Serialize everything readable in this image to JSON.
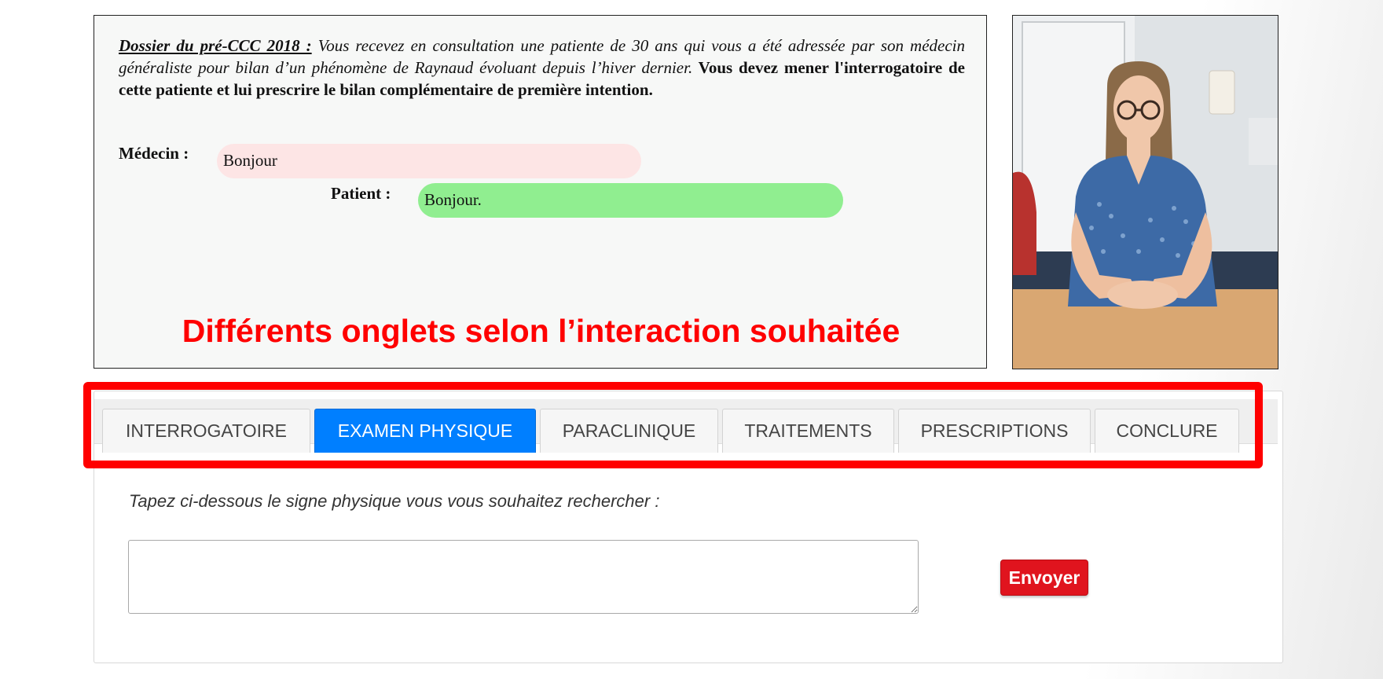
{
  "case": {
    "label": "Dossier du pré-CCC 2018 :",
    "intro": " Vous recevez en consultation une patiente de 30 ans qui vous a été adressée par son médecin généraliste pour bilan d’un phénomène de Raynaud évoluant depuis l’hiver dernier.",
    "task": " Vous devez mener l'interrogatoire de cette patiente et lui prescrire le bilan complémentaire de première intention."
  },
  "dialogue": {
    "doctor_label": "Médecin :",
    "doctor_text": "Bonjour",
    "patient_label": "Patient :",
    "patient_text": "Bonjour."
  },
  "overlay_caption": "Différents onglets selon l’interaction souhaitée",
  "tabs": [
    {
      "label": "INTERROGATOIRE",
      "active": false
    },
    {
      "label": "EXAMEN PHYSIQUE",
      "active": true
    },
    {
      "label": "PARACLINIQUE",
      "active": false
    },
    {
      "label": "TRAITEMENTS",
      "active": false
    },
    {
      "label": "PRESCRIPTIONS",
      "active": false
    },
    {
      "label": "CONCLURE",
      "active": false
    }
  ],
  "exam": {
    "instruction": "Tapez ci-dessous le signe physique vous vous souhaitez rechercher :",
    "input_value": "",
    "send_label": "Envoyer"
  },
  "colors": {
    "doctor_bubble": "#fde5e5",
    "patient_bubble": "#90ee90",
    "active_tab": "#007fff",
    "send_button": "#e0141e",
    "highlight": "#ff0000"
  }
}
